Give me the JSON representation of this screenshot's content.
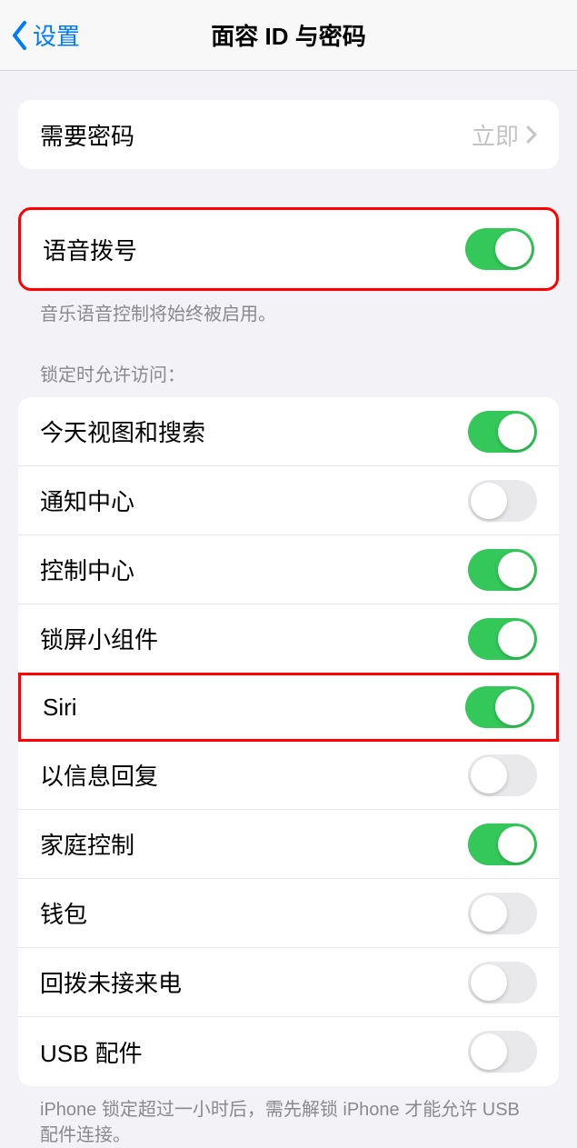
{
  "nav": {
    "back_label": "设置",
    "title": "面容 ID 与密码"
  },
  "passcode_group": {
    "require_passcode": {
      "label": "需要密码",
      "value": "立即"
    }
  },
  "voice_dial": {
    "label": "语音拨号",
    "on": true,
    "footer": "音乐语音控制将始终被启用。"
  },
  "locked_access": {
    "header": "锁定时允许访问：",
    "items": [
      {
        "key": "today-search",
        "label": "今天视图和搜索",
        "on": true
      },
      {
        "key": "notification-center",
        "label": "通知中心",
        "on": false
      },
      {
        "key": "control-center",
        "label": "控制中心",
        "on": true
      },
      {
        "key": "lockscreen-widgets",
        "label": "锁屏小组件",
        "on": true
      },
      {
        "key": "siri",
        "label": "Siri",
        "on": true
      },
      {
        "key": "reply-message",
        "label": "以信息回复",
        "on": false
      },
      {
        "key": "home-control",
        "label": "家庭控制",
        "on": true
      },
      {
        "key": "wallet",
        "label": "钱包",
        "on": false
      },
      {
        "key": "return-missed-calls",
        "label": "回拨未接来电",
        "on": false
      },
      {
        "key": "usb-accessories",
        "label": "USB 配件",
        "on": false
      }
    ],
    "footer": "iPhone 锁定超过一小时后，需先解锁 iPhone 才能允许 USB 配件连接。"
  },
  "highlighted_rows": [
    "voice-dial",
    "siri"
  ]
}
